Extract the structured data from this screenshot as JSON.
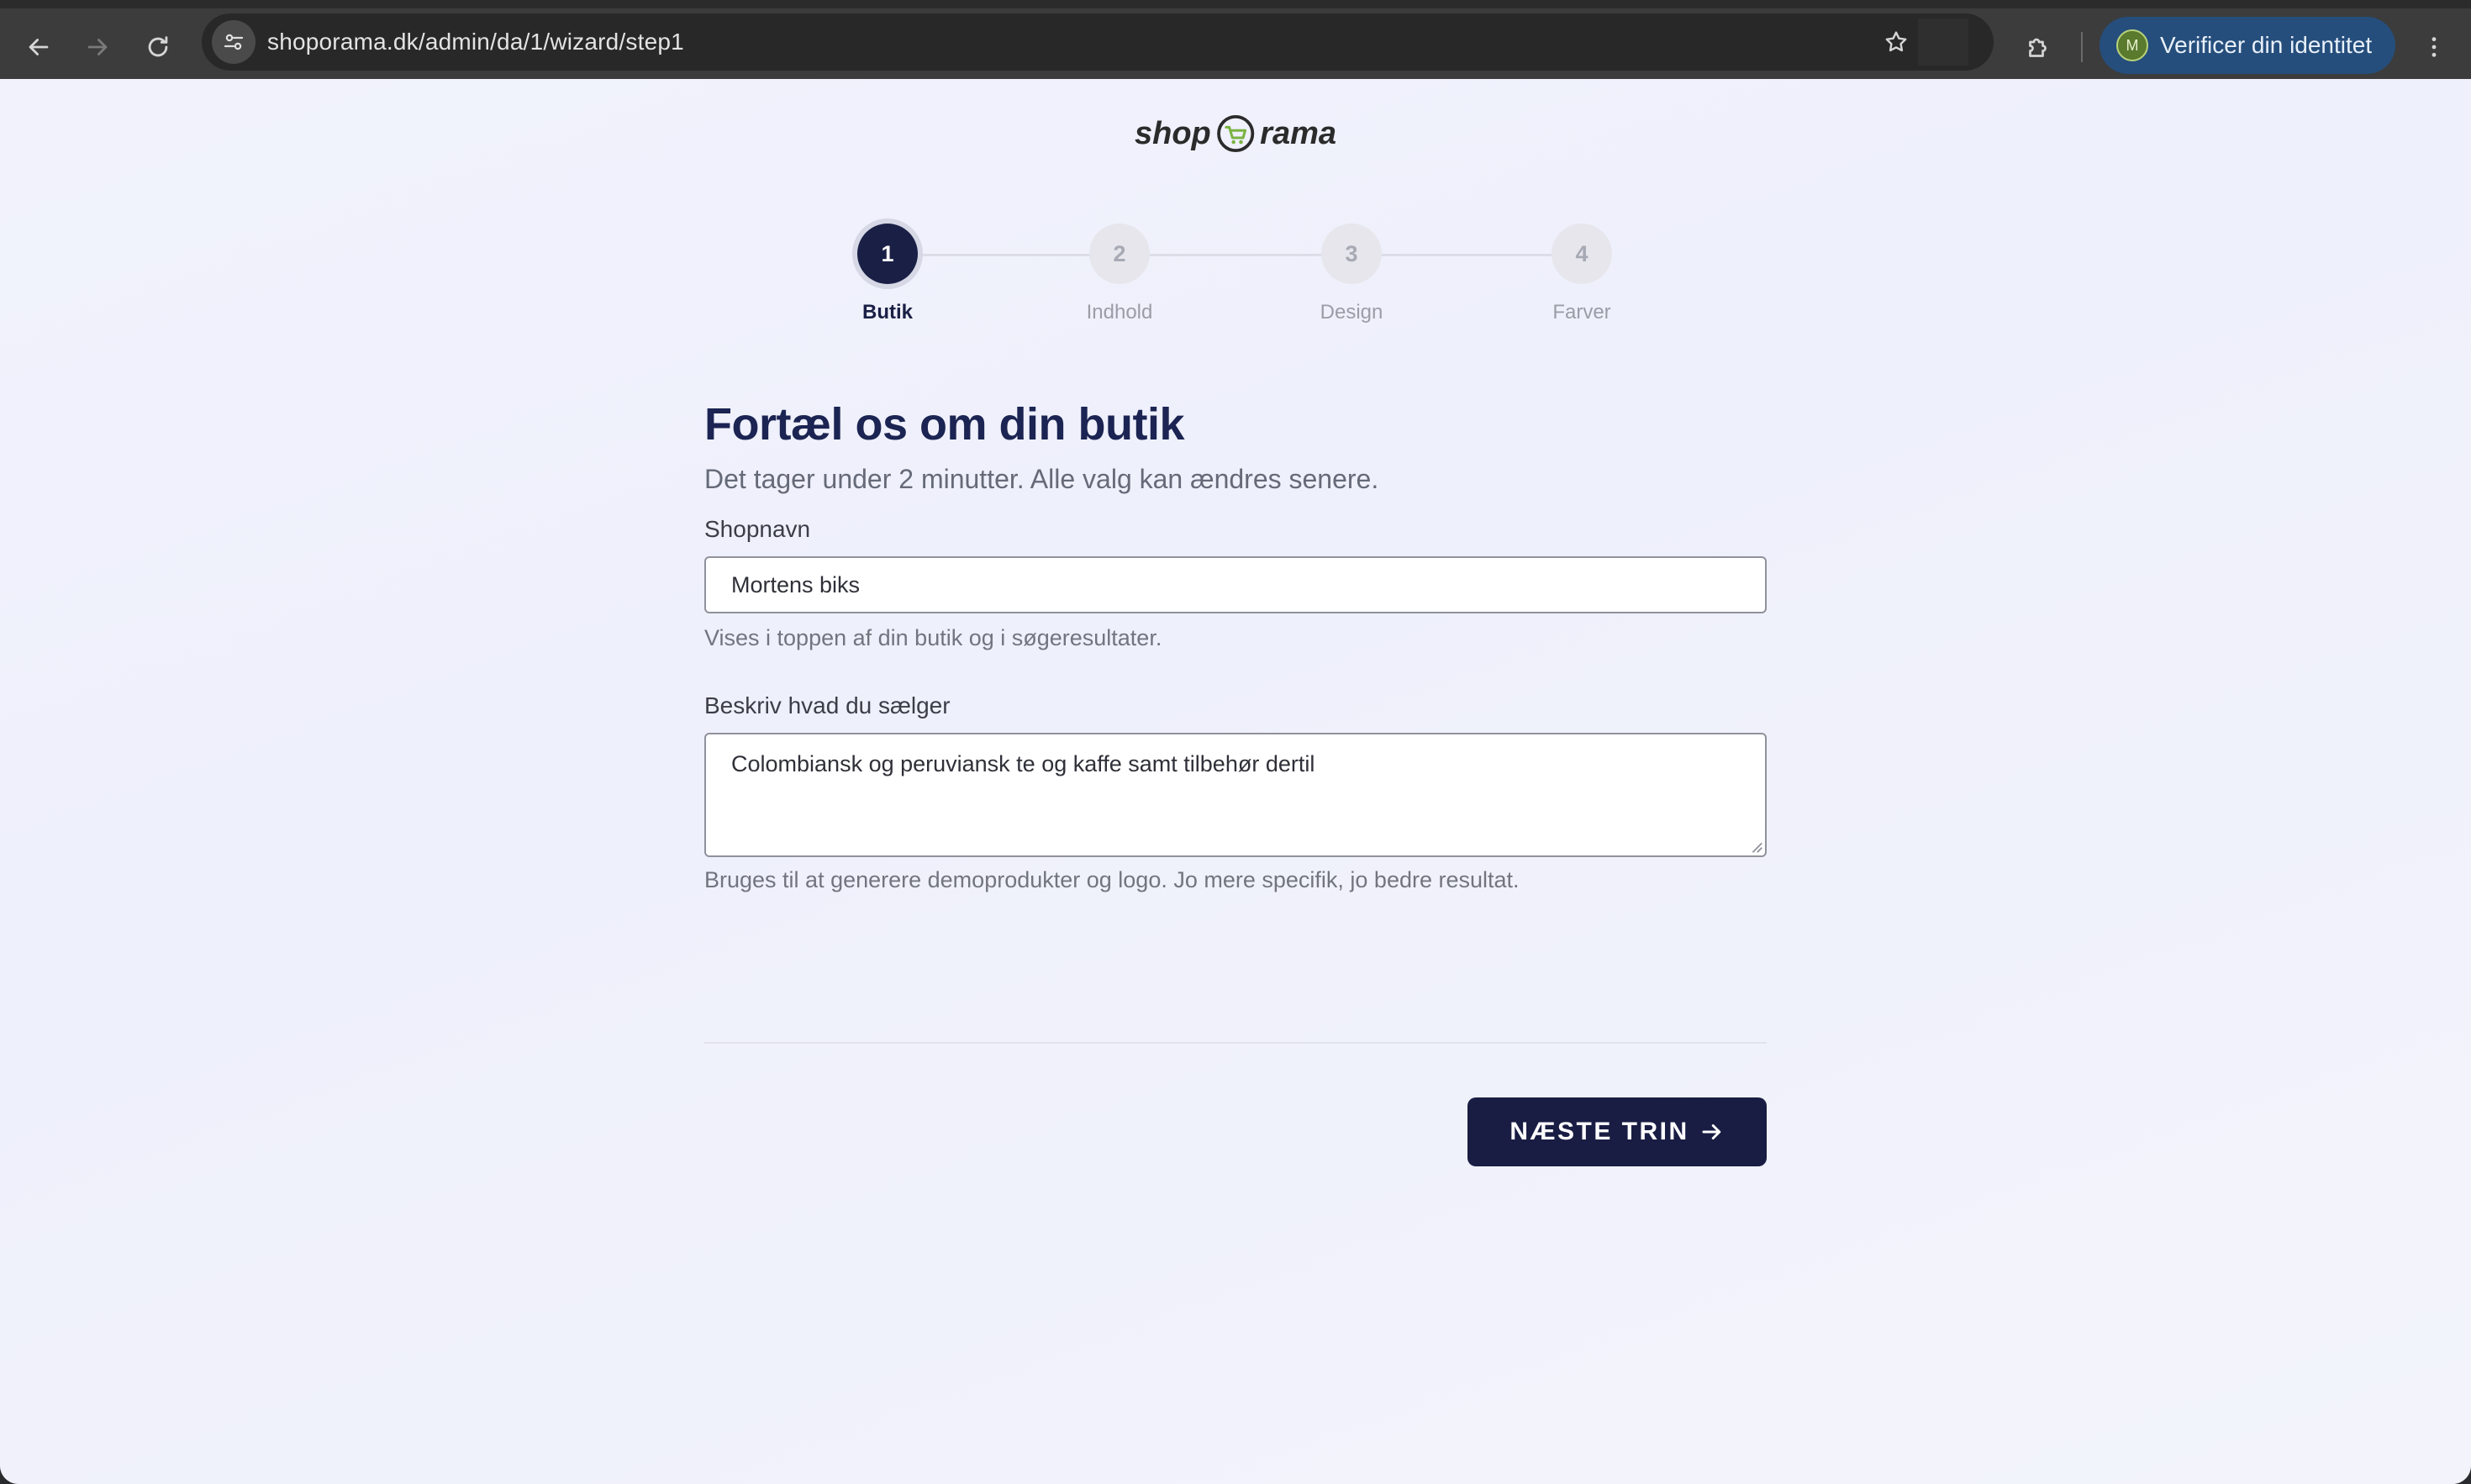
{
  "browser": {
    "url": "shoporama.dk/admin/da/1/wizard/step1",
    "profile_initial": "M",
    "profile_button_label": "Verificer din identitet"
  },
  "logo": {
    "left_text": "shop",
    "right_text": "rama"
  },
  "stepper": {
    "steps": [
      {
        "number": "1",
        "label": "Butik",
        "state": "active"
      },
      {
        "number": "2",
        "label": "Indhold",
        "state": "upcoming"
      },
      {
        "number": "3",
        "label": "Design",
        "state": "upcoming"
      },
      {
        "number": "4",
        "label": "Farver",
        "state": "upcoming"
      }
    ]
  },
  "form": {
    "title": "Fortæl os om din butik",
    "subtitle": "Det tager under 2 minutter. Alle valg kan ændres senere.",
    "shop_name": {
      "label": "Shopnavn",
      "value": "Mortens biks",
      "help": "Vises i toppen af din butik og i søgeresultater."
    },
    "description": {
      "label": "Beskriv hvad du sælger",
      "value": "Colombiansk og peruviansk te og kaffe samt tilbehør dertil",
      "help": "Bruges til at generere demoprodukter og logo. Jo mere specifik, jo bedre resultat."
    },
    "next_button_label": "NÆSTE TRIN"
  },
  "colors": {
    "primary": "#191d43",
    "heading": "#1b2452",
    "chrome": "#3c3c3c",
    "profile_button": "#254e7c"
  }
}
